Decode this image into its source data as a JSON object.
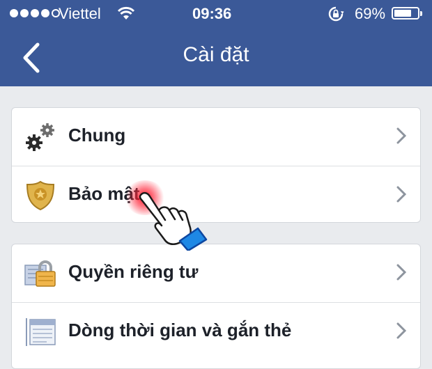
{
  "status_bar": {
    "carrier": "Viettel",
    "time": "09:36",
    "battery_percent": "69%",
    "battery_level": 0.69,
    "signal_bars_filled": 4,
    "signal_bars_total": 5,
    "icons": [
      "signal-dots-icon",
      "wifi-icon",
      "rotation-lock-icon",
      "battery-icon"
    ]
  },
  "header": {
    "title": "Cài đặt",
    "back_icon": "chevron-left-icon",
    "background": "#3b5998"
  },
  "settings": {
    "group1": [
      {
        "label": "Chung",
        "icon": "gears-icon"
      },
      {
        "label": "Bảo mật",
        "icon": "security-badge-icon"
      }
    ],
    "group2": [
      {
        "label": "Quyền riêng tư",
        "icon": "privacy-lock-icon"
      },
      {
        "label": "Dòng thời gian và gắn thẻ",
        "icon": "timeline-icon"
      }
    ]
  },
  "overlay": {
    "tap_indicator": "tap-hand-icon",
    "glow_color": "#ff1a2e"
  }
}
